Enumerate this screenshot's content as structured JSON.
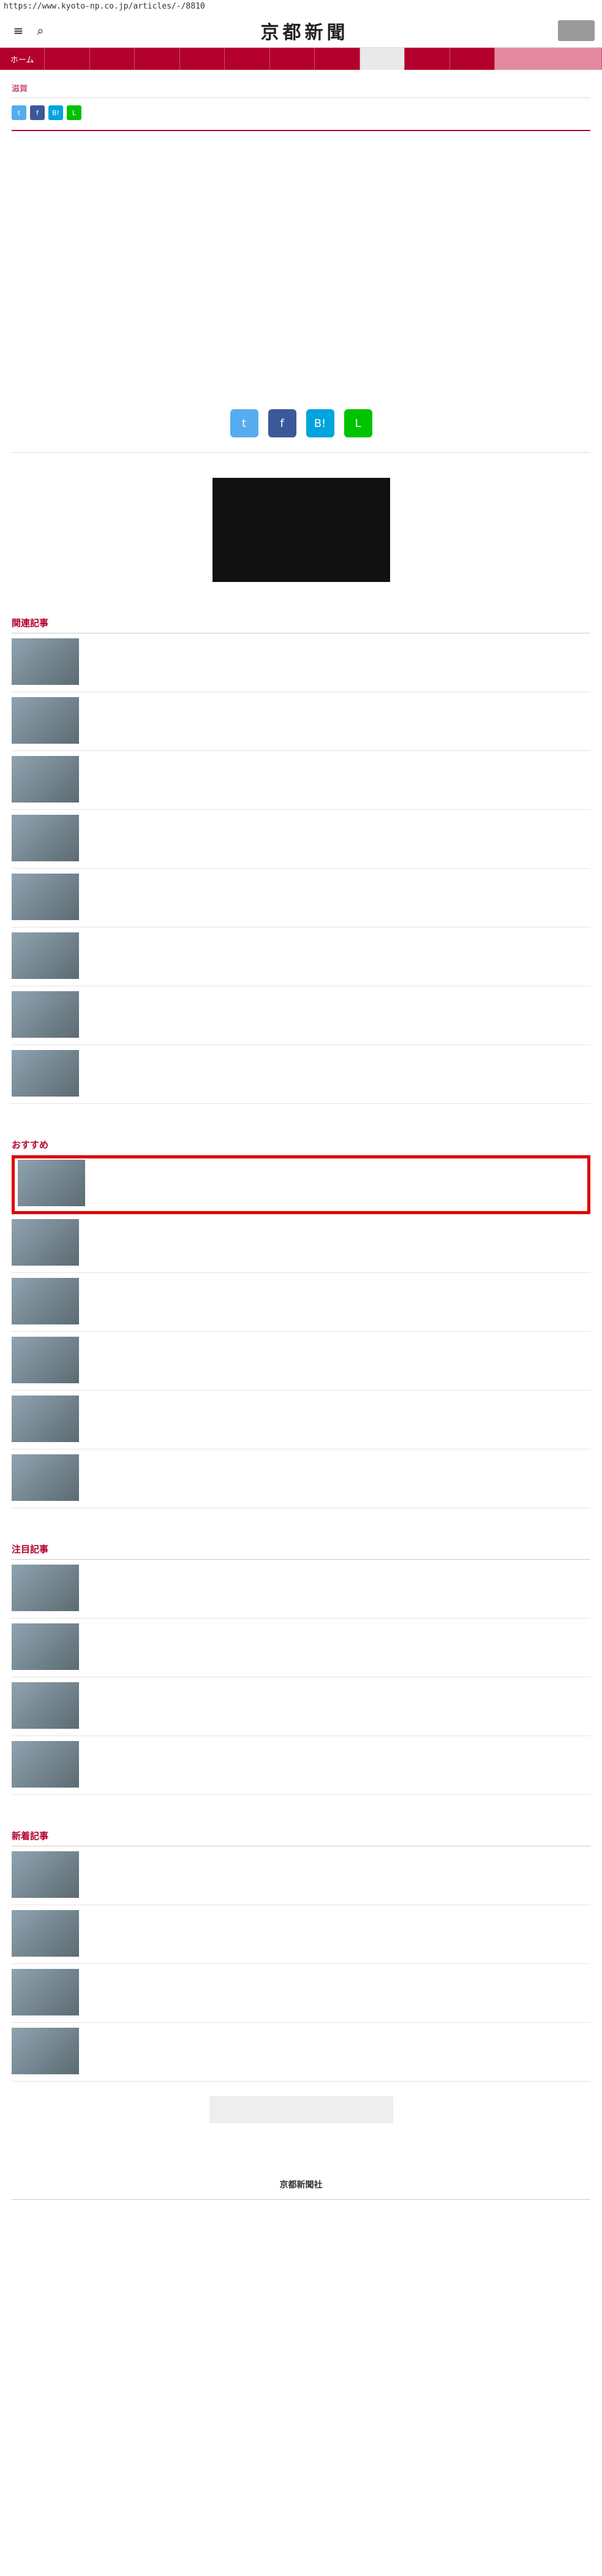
{
  "browser": {
    "url": "https://www.kyoto-np.co.jp/articles/-/8810"
  },
  "header": {
    "logo": "京都新聞",
    "menu_icon": "menu-icon",
    "search_icon": "search-icon",
    "digital_label": ""
  },
  "nav": {
    "items": [
      "ホーム",
      "",
      "",
      "",
      "",
      "",
      "",
      "",
      "",
      "",
      "",
      ""
    ]
  },
  "article": {
    "kicker": "滋賀",
    "title": "",
    "date": "",
    "paragraphs": [
      "",
      "",
      "",
      "",
      ""
    ]
  },
  "share": [
    {
      "icon": "twitter-icon",
      "glyph": "t",
      "color": "#55acee"
    },
    {
      "icon": "facebook-icon",
      "glyph": "f",
      "color": "#3b5998"
    },
    {
      "icon": "hatena-icon",
      "glyph": "B!",
      "color": "#00a4de"
    },
    {
      "icon": "line-icon",
      "glyph": "L",
      "color": "#00c300"
    }
  ],
  "breadcrumb": "",
  "sections": [
    {
      "title": "関連記事",
      "rows": [
        "",
        "",
        "",
        "",
        "",
        "",
        "",
        ""
      ]
    },
    {
      "title": "おすすめ",
      "rows": [
        "",
        "",
        "",
        "",
        "",
        ""
      ]
    },
    {
      "title": "注目記事",
      "rows": [
        "",
        "",
        "",
        ""
      ]
    },
    {
      "title": "新着記事",
      "rows": [
        "",
        "",
        "",
        ""
      ]
    }
  ],
  "footer": {
    "logo": "京都新聞社",
    "links": ""
  }
}
